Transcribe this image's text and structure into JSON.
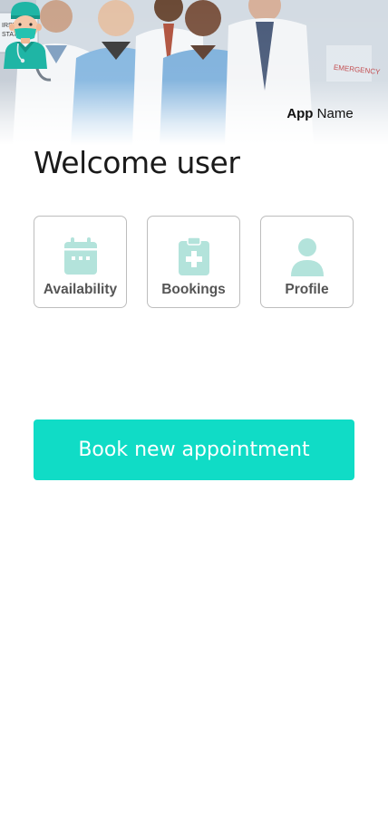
{
  "header": {
    "app_name_bold": "App",
    "app_name_rest": " Name",
    "background_sign_left": "IRST AID\nSTATION",
    "background_sign_right": "EMERGENCY"
  },
  "main": {
    "welcome_text": "Welcome user",
    "tiles": [
      {
        "label": "Availability",
        "icon": "calendar-icon"
      },
      {
        "label": "Bookings",
        "icon": "clipboard-plus-icon"
      },
      {
        "label": "Profile",
        "icon": "user-icon"
      }
    ],
    "book_button_label": "Book new appointment"
  },
  "colors": {
    "accent": "#10dcc6",
    "icon_tint": "#b3e3db",
    "tile_border": "#bdbdbd",
    "tile_label": "#555555"
  }
}
